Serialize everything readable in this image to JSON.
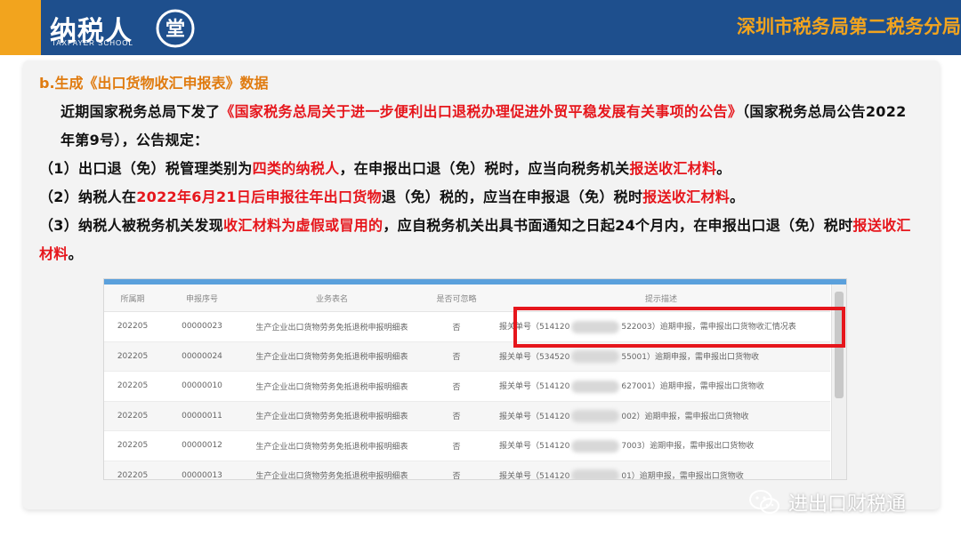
{
  "header": {
    "logo_text": "纳税人",
    "logo_sub": "TAXPAYER SCHOOL",
    "logo_mark_glyph": "堂",
    "agency": "深圳市税务局第二税务分局"
  },
  "content": {
    "section_title": "b.生成《出口货物收汇申报表》数据",
    "intro": {
      "p1": "近期国家税务总局下发了",
      "p2": "《国家税务总局关于进一步便利出口退税办理促进外贸平稳发展有关事项的公告》",
      "p3": "（国家税务总局公告2022年第9号），公告规定："
    },
    "item1": {
      "p1": "（1）出口退（免）税管理类别为",
      "p2": "四类的纳税人",
      "p3": "，在申报出口退（免）税时，应当向税务机关",
      "p4": "报送收汇材料",
      "p5": "。"
    },
    "item2": {
      "p1": "（2）纳税人在",
      "p2": "2022年6月21日后申报往年出口货物",
      "p3": "退（免）税的，应当在申报退（免）税时",
      "p4": "报送收汇材料",
      "p5": "。"
    },
    "item3": {
      "p1": "（3）纳税人被税务机关发现",
      "p2": "收汇材料为虚假或冒用的",
      "p3": "，应自税务机关出具书面通知之日起24个月内，在申报出口退（免）税时",
      "p4": "报送收汇材料",
      "p5": "。"
    }
  },
  "table": {
    "headers": [
      "所属期",
      "申报序号",
      "业务表名",
      "是否可忽略",
      "提示描述"
    ],
    "rows": [
      {
        "period": "202205",
        "seq": "00000023",
        "name": "生产企业出口货物劳务免抵退税申报明细表",
        "ignore": "否",
        "desc_a": "报关单号（514120",
        "desc_b": "522003）逾期申报，需申报出口货物收汇情况表"
      },
      {
        "period": "202205",
        "seq": "00000024",
        "name": "生产企业出口货物劳务免抵退税申报明细表",
        "ignore": "否",
        "desc_a": "报关单号（534520",
        "desc_b": "55001）逾期申报，需申报出口货物收"
      },
      {
        "period": "202205",
        "seq": "00000010",
        "name": "生产企业出口货物劳务免抵退税申报明细表",
        "ignore": "否",
        "desc_a": "报关单号（514120",
        "desc_b": "627001）逾期申报，需申报出口货物收"
      },
      {
        "period": "202205",
        "seq": "00000011",
        "name": "生产企业出口货物劳务免抵退税申报明细表",
        "ignore": "否",
        "desc_a": "报关单号（514120",
        "desc_b": "002）逾期申报，需申报出口货物收"
      },
      {
        "period": "202205",
        "seq": "00000012",
        "name": "生产企业出口货物劳务免抵退税申报明细表",
        "ignore": "否",
        "desc_a": "报关单号（514120",
        "desc_b": "7003）逾期申报，需申报出口货物收"
      },
      {
        "period": "202205",
        "seq": "00000013",
        "name": "生产企业出口货物劳务免抵退税申报明细表",
        "ignore": "否",
        "desc_a": "报关单号（514120",
        "desc_b": "01）逾期申报，需申报出口货物收"
      }
    ]
  },
  "watermark": {
    "text": "进出口财税通",
    "icon": "wechat-icon"
  },
  "colors": {
    "header_bg": "#1e4f8d",
    "accent_orange": "#f2a41e",
    "red": "#e6161c",
    "title_orange": "#e07b0f"
  }
}
